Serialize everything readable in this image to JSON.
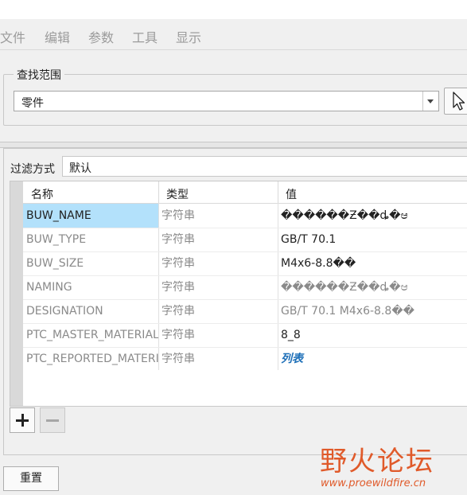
{
  "menu": [
    "文件",
    "编辑",
    "参数",
    "工具",
    "显示"
  ],
  "search_scope": {
    "label": "查找范围",
    "value": "零件"
  },
  "filter": {
    "label": "过滤方式",
    "value": "默认"
  },
  "table": {
    "headers": [
      "名称",
      "类型",
      "值"
    ],
    "rows": [
      {
        "name": "BUW_NAME",
        "type": "字符串",
        "value": "������Ƶ��ȡ�ಆ"
      },
      {
        "name": "BUW_TYPE",
        "type": "字符串",
        "value": "GB/T 70.1"
      },
      {
        "name": "BUW_SIZE",
        "type": "字符串",
        "value": "M4x6-8.8��"
      },
      {
        "name": "NAMING",
        "type": "字符串",
        "value": "������Ƶ��ȡ�ಆ"
      },
      {
        "name": "DESIGNATION",
        "type": "字符串",
        "value": "GB/T 70.1 M4x6-8.8��"
      },
      {
        "name": "PTC_MASTER_MATERIAL",
        "type": "字符串",
        "value": "8_8"
      },
      {
        "name": "PTC_REPORTED_MATERIAL",
        "type": "字符串",
        "value": "列表"
      }
    ]
  },
  "buttons": {
    "reset": "重置"
  },
  "watermark": {
    "title": "野火论坛",
    "url": "www.proewildfire.cn"
  },
  "colors": {
    "selection": "#b3e1fb",
    "link": "#1d6fb8",
    "watermark": "#e05a2a"
  }
}
